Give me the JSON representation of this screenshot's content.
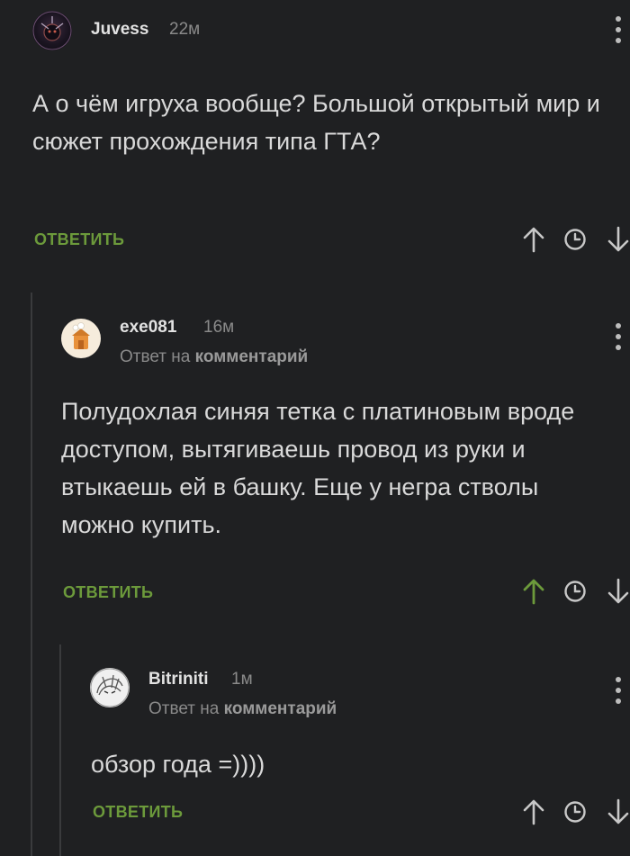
{
  "colors": {
    "background": "#1f2022",
    "reply_green": "#6c9a3b",
    "upvoted_green": "#6c9a3b",
    "muted": "#8a8a8a"
  },
  "comments": [
    {
      "username": "Juvess",
      "time": "22м",
      "text": "А о чём игруха вообще? Большой открытый мир и сюжет прохождения типа ГТА?",
      "reply_label": "ОТВЕТИТЬ",
      "upvoted": false
    },
    {
      "username": "exe081",
      "time": "16м",
      "reply_prefix": "Ответ на",
      "reply_target": "комментарий",
      "text": "Полудохлая синяя тетка с платиновым вроде доступом,  вытягиваешь провод из руки и втыкаешь ей в башку.  Еще у негра стволы можно купить.",
      "reply_label": "ОТВЕТИТЬ",
      "upvoted": true
    },
    {
      "username": "Bitriniti",
      "time": "1м",
      "reply_prefix": "Ответ на",
      "reply_target": "комментарий",
      "text": "обзор года =))))",
      "reply_label": "ОТВЕТИТЬ",
      "upvoted": false
    }
  ],
  "icons": {
    "upvote": "arrow-up-icon",
    "history": "clock-icon",
    "downvote": "arrow-down-icon",
    "more": "more-vertical-icon"
  }
}
